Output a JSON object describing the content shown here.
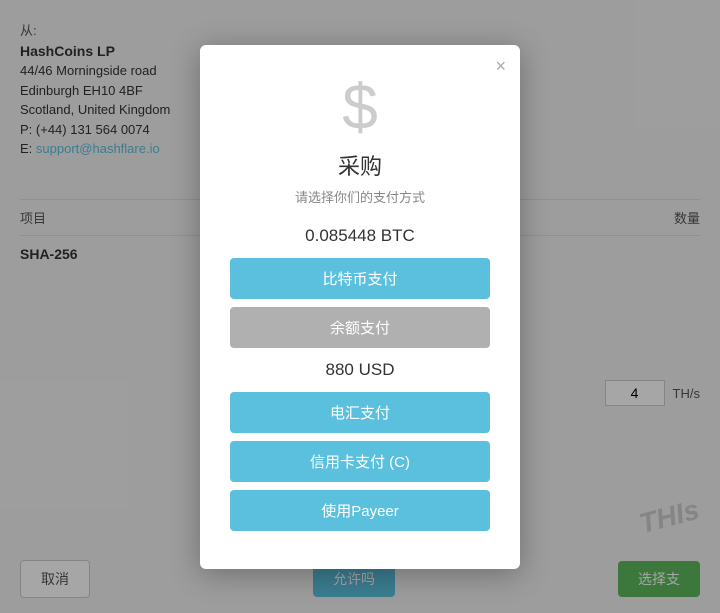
{
  "background": {
    "from_label": "从:",
    "company": "HashCoins LP",
    "address_lines": [
      "44/46 Morningside road",
      "Edinburgh EH10 4BF",
      "Scotland, United Kingdom",
      "P: (+44) 131 564 0074"
    ],
    "email_label": "E:",
    "email": "support@hashflare.io",
    "table": {
      "col_item": "项目",
      "col_qty": "数量",
      "row_item": "SHA-256",
      "row_qty": "4",
      "row_unit": "TH/s"
    },
    "btn_cancel": "取消",
    "btn_next": "允许吗",
    "btn_select": "选择支"
  },
  "modal": {
    "title": "采购",
    "subtitle": "请选择你们的支付方式",
    "btc_amount": "0.085448 BTC",
    "usd_amount": "880 USD",
    "btn_bitcoin": "比特币支付",
    "btn_balance": "余额支付",
    "btn_wire": "电汇支付",
    "btn_credit": "信用卡支付 (C)",
    "btn_payeer": "使用Payeer",
    "close_label": "×"
  },
  "watermark": {
    "text": "THIs"
  }
}
